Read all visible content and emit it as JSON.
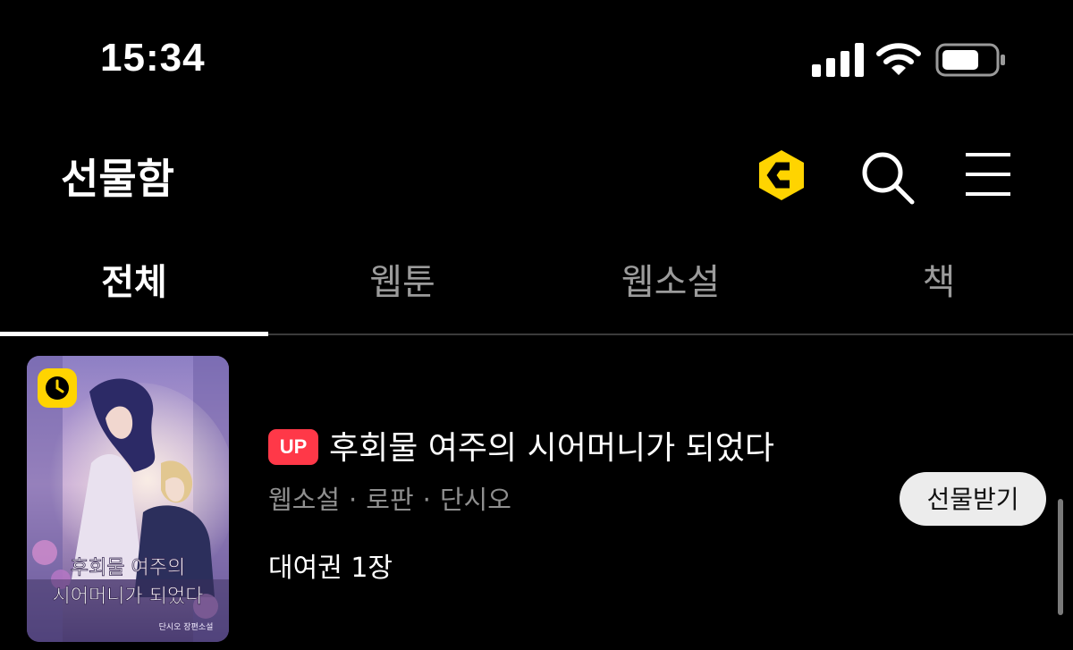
{
  "status_bar": {
    "time": "15:34",
    "icons": [
      "cellular-signal-icon",
      "wifi-icon",
      "battery-icon"
    ]
  },
  "header": {
    "title": "선물함",
    "icons": [
      "cash-coin-icon",
      "search-icon",
      "menu-icon"
    ],
    "accent_color": "#ffd400"
  },
  "tabs": [
    {
      "label": "전체",
      "active": true
    },
    {
      "label": "웹툰",
      "active": false
    },
    {
      "label": "웹소설",
      "active": false
    },
    {
      "label": "책",
      "active": false
    }
  ],
  "gift_item": {
    "badge": "UP",
    "badge_color": "#ff3848",
    "title": "후회물 여주의 시어머니가 되었다",
    "category": "웹소설",
    "genre": "로판",
    "author": "단시오",
    "separator": "·",
    "voucher": "대여권 1장",
    "action_label": "선물받기",
    "cover": {
      "title_line1": "후회물 여주의",
      "title_line2": "시어머니가 되었다",
      "credit": "단시오 장편소설",
      "badge_icon": "clock-icon"
    }
  }
}
